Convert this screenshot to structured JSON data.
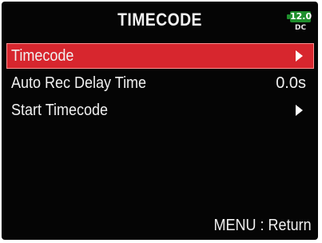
{
  "header": {
    "title": "TIMECODE",
    "battery": {
      "value": "12.0",
      "source": "DC",
      "color": "#1f8f2d"
    }
  },
  "menu": {
    "items": [
      {
        "label": "Timecode",
        "value": "",
        "has_submenu": true,
        "selected": true
      },
      {
        "label": "Auto Rec Delay Time",
        "value": "0.0s",
        "has_submenu": false,
        "selected": false
      },
      {
        "label": "Start Timecode",
        "value": "",
        "has_submenu": true,
        "selected": false
      }
    ]
  },
  "footer": {
    "hint": "MENU : Return"
  },
  "colors": {
    "background": "#050505",
    "selection": "#d7262e",
    "text": "#f0f0f0"
  }
}
